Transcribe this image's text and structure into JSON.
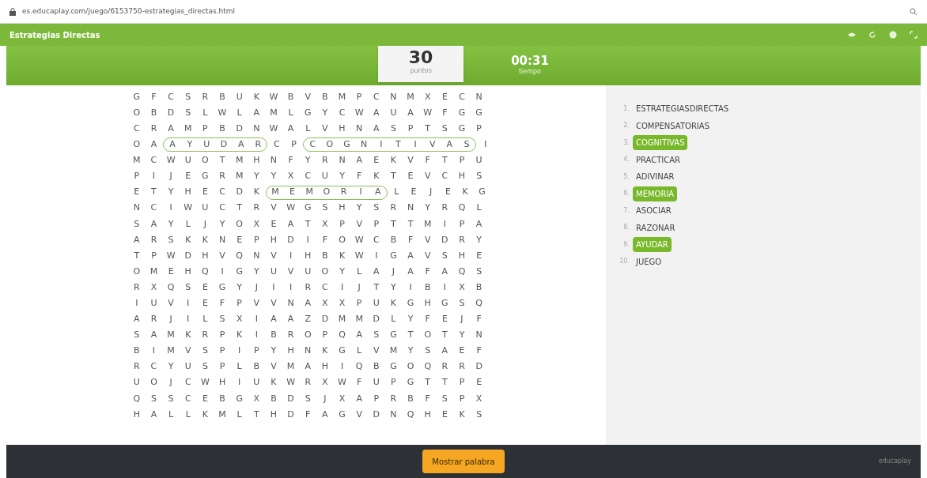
{
  "browser": {
    "url": "es.educaplay.com/juego/6153750-estrategias_directas.html"
  },
  "title_bar": {
    "title": "Estrategias Directas"
  },
  "score": {
    "value": "30",
    "label": "puntos"
  },
  "timer": {
    "value": "00:31",
    "label": "tiempo"
  },
  "grid": [
    {
      "segments": [
        {
          "letters": [
            "G",
            "F",
            "C",
            "S",
            "R",
            "B",
            "U",
            "K",
            "W",
            "B",
            "V",
            "B",
            "M",
            "P",
            "C",
            "N",
            "M",
            "X",
            "E",
            "C",
            "N"
          ],
          "found": false
        }
      ]
    },
    {
      "segments": [
        {
          "letters": [
            "O",
            "B",
            "D",
            "S",
            "L",
            "W",
            "L",
            "A",
            "M",
            "L",
            "G",
            "Y",
            "C",
            "W",
            "A",
            "U",
            "A",
            "W",
            "F",
            "G",
            "G"
          ],
          "found": false
        }
      ]
    },
    {
      "segments": [
        {
          "letters": [
            "C",
            "R",
            "A",
            "M",
            "P",
            "B",
            "D",
            "N",
            "W",
            "A",
            "L",
            "V",
            "H",
            "N",
            "A",
            "S",
            "P",
            "T",
            "S",
            "G",
            "P"
          ],
          "found": false
        }
      ]
    },
    {
      "segments": [
        {
          "letters": [
            "O",
            "A"
          ],
          "found": false
        },
        {
          "letters": [
            "A",
            "Y",
            "U",
            "D",
            "A",
            "R"
          ],
          "found": true
        },
        {
          "letters": [
            "C",
            "P"
          ],
          "found": false
        },
        {
          "letters": [
            "C",
            "O",
            "G",
            "N",
            "I",
            "T",
            "I",
            "V",
            "A",
            "S"
          ],
          "found": true
        },
        {
          "letters": [
            "I"
          ],
          "found": false
        }
      ]
    },
    {
      "segments": [
        {
          "letters": [
            "M",
            "C",
            "W",
            "U",
            "O",
            "T",
            "M",
            "H",
            "N",
            "F",
            "Y",
            "R",
            "N",
            "A",
            "E",
            "K",
            "V",
            "F",
            "T",
            "P",
            "U"
          ],
          "found": false
        }
      ]
    },
    {
      "segments": [
        {
          "letters": [
            "P",
            "I",
            "J",
            "E",
            "G",
            "R",
            "M",
            "Y",
            "Y",
            "X",
            "C",
            "U",
            "Y",
            "F",
            "K",
            "T",
            "E",
            "V",
            "C",
            "H",
            "S"
          ],
          "found": false
        }
      ]
    },
    {
      "segments": [
        {
          "letters": [
            "E",
            "T",
            "Y",
            "H",
            "E",
            "C",
            "D",
            "K"
          ],
          "found": false
        },
        {
          "letters": [
            "M",
            "E",
            "M",
            "O",
            "R",
            "I",
            "A"
          ],
          "found": true
        },
        {
          "letters": [
            "L",
            "E",
            "J",
            "E",
            "K",
            "G"
          ],
          "found": false
        }
      ]
    },
    {
      "segments": [
        {
          "letters": [
            "N",
            "C",
            "I",
            "W",
            "U",
            "C",
            "T",
            "R",
            "V",
            "W",
            "G",
            "S",
            "H",
            "Y",
            "S",
            "R",
            "N",
            "Y",
            "R",
            "Q",
            "L"
          ],
          "found": false
        }
      ]
    },
    {
      "segments": [
        {
          "letters": [
            "S",
            "A",
            "Y",
            "L",
            "J",
            "Y",
            "O",
            "X",
            "E",
            "A",
            "T",
            "X",
            "P",
            "V",
            "P",
            "T",
            "T",
            "M",
            "I",
            "P",
            "A"
          ],
          "found": false
        }
      ]
    },
    {
      "segments": [
        {
          "letters": [
            "A",
            "R",
            "S",
            "K",
            "K",
            "N",
            "E",
            "P",
            "H",
            "D",
            "I",
            "F",
            "O",
            "W",
            "C",
            "B",
            "F",
            "V",
            "D",
            "R",
            "Y"
          ],
          "found": false
        }
      ]
    },
    {
      "segments": [
        {
          "letters": [
            "T",
            "P",
            "W",
            "D",
            "H",
            "V",
            "Q",
            "N",
            "V",
            "I",
            "H",
            "B",
            "K",
            "W",
            "I",
            "G",
            "A",
            "V",
            "S",
            "H",
            "E"
          ],
          "found": false
        }
      ]
    },
    {
      "segments": [
        {
          "letters": [
            "O",
            "M",
            "E",
            "H",
            "Q",
            "I",
            "G",
            "Y",
            "U",
            "V",
            "U",
            "O",
            "Y",
            "L",
            "A",
            "J",
            "A",
            "F",
            "A",
            "Q",
            "S"
          ],
          "found": false
        }
      ]
    },
    {
      "segments": [
        {
          "letters": [
            "R",
            "X",
            "Q",
            "S",
            "E",
            "G",
            "Y",
            "J",
            "I",
            "I",
            "R",
            "C",
            "I",
            "J",
            "T",
            "Y",
            "I",
            "B",
            "I",
            "X",
            "B"
          ],
          "found": false
        }
      ]
    },
    {
      "segments": [
        {
          "letters": [
            "I",
            "U",
            "V",
            "I",
            "E",
            "F",
            "P",
            "V",
            "V",
            "N",
            "A",
            "X",
            "X",
            "P",
            "U",
            "K",
            "G",
            "H",
            "G",
            "S",
            "Q"
          ],
          "found": false
        }
      ]
    },
    {
      "segments": [
        {
          "letters": [
            "A",
            "R",
            "J",
            "I",
            "L",
            "S",
            "X",
            "I",
            "A",
            "A",
            "Z",
            "D",
            "M",
            "M",
            "D",
            "L",
            "Y",
            "F",
            "E",
            "J",
            "F"
          ],
          "found": false
        }
      ]
    },
    {
      "segments": [
        {
          "letters": [
            "S",
            "A",
            "M",
            "K",
            "R",
            "P",
            "K",
            "I",
            "B",
            "R",
            "O",
            "P",
            "Q",
            "A",
            "S",
            "G",
            "T",
            "O",
            "T",
            "Y",
            "N"
          ],
          "found": false
        }
      ]
    },
    {
      "segments": [
        {
          "letters": [
            "B",
            "I",
            "M",
            "V",
            "S",
            "P",
            "I",
            "P",
            "Y",
            "H",
            "N",
            "K",
            "G",
            "L",
            "V",
            "M",
            "Y",
            "S",
            "A",
            "E",
            "F"
          ],
          "found": false
        }
      ]
    },
    {
      "segments": [
        {
          "letters": [
            "R",
            "C",
            "Y",
            "U",
            "S",
            "P",
            "L",
            "B",
            "V",
            "M",
            "A",
            "H",
            "I",
            "Q",
            "B",
            "G",
            "O",
            "Q",
            "R",
            "R",
            "D"
          ],
          "found": false
        }
      ]
    },
    {
      "segments": [
        {
          "letters": [
            "U",
            "O",
            "J",
            "C",
            "W",
            "H",
            "I",
            "U",
            "K",
            "W",
            "R",
            "X",
            "W",
            "F",
            "U",
            "P",
            "G",
            "T",
            "T",
            "P",
            "E"
          ],
          "found": false
        }
      ]
    },
    {
      "segments": [
        {
          "letters": [
            "Q",
            "S",
            "S",
            "C",
            "E",
            "B",
            "G",
            "X",
            "B",
            "D",
            "S",
            "J",
            "X",
            "A",
            "P",
            "R",
            "B",
            "F",
            "S",
            "P",
            "X"
          ],
          "found": false
        }
      ]
    },
    {
      "segments": [
        {
          "letters": [
            "H",
            "A",
            "L",
            "L",
            "K",
            "M",
            "L",
            "T",
            "H",
            "D",
            "F",
            "A",
            "G",
            "V",
            "D",
            "N",
            "Q",
            "H",
            "E",
            "K",
            "S"
          ],
          "found": false
        }
      ]
    }
  ],
  "words": [
    {
      "number": "1.",
      "word": "ESTRATEGIASDIRECTAS",
      "found": false
    },
    {
      "number": "2.",
      "word": "COMPENSATORIAS",
      "found": false
    },
    {
      "number": "3.",
      "word": "COGNITIVAS",
      "found": true
    },
    {
      "number": "4.",
      "word": "PRACTICAR",
      "found": false
    },
    {
      "number": "5.",
      "word": "ADIVINAR",
      "found": false
    },
    {
      "number": "6.",
      "word": "MEMORIA",
      "found": true
    },
    {
      "number": "7.",
      "word": "ASOCIAR",
      "found": false
    },
    {
      "number": "8.",
      "word": "RAZONAR",
      "found": false
    },
    {
      "number": "9.",
      "word": "AYUDAR",
      "found": true
    },
    {
      "number": "10.",
      "word": "JUEGO",
      "found": false
    }
  ],
  "footer": {
    "button": "Mostrar palabra",
    "logo": "educaplay"
  }
}
